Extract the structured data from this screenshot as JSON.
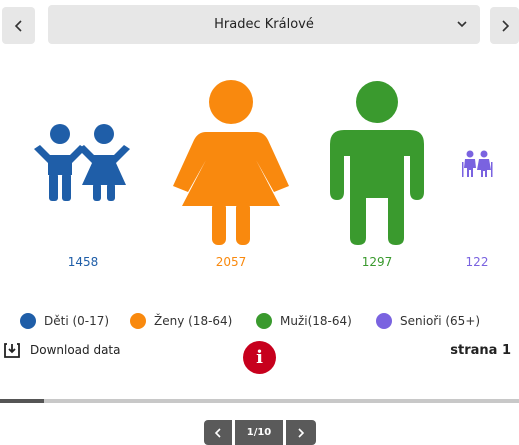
{
  "header": {
    "region": "Hradec Králové",
    "prev_icon": "chevron-left-icon",
    "next_icon": "chevron-right-icon",
    "dropdown_icon": "chevron-down-icon"
  },
  "groups": [
    {
      "key": "children",
      "icon": "children-icon",
      "count": "1458",
      "color": "#1f5ea8",
      "legend": "Děti (0-17)"
    },
    {
      "key": "women",
      "icon": "woman-icon",
      "count": "2057",
      "color": "#f9890e",
      "legend": "Ženy (18-64)"
    },
    {
      "key": "men",
      "icon": "man-icon",
      "count": "1297",
      "color": "#3a9a2e",
      "legend": "Muži(18-64)"
    },
    {
      "key": "seniors",
      "icon": "seniors-icon",
      "count": "122",
      "color": "#7a63e0",
      "legend": "Senioři (65+)"
    }
  ],
  "footer": {
    "download_label": "Download data",
    "download_icon": "download-icon",
    "info_icon": "info-icon",
    "info_glyph": "i",
    "page_label": "strana 1"
  },
  "progress": {
    "fraction": 0.085
  },
  "pager": {
    "label": "1/10"
  }
}
